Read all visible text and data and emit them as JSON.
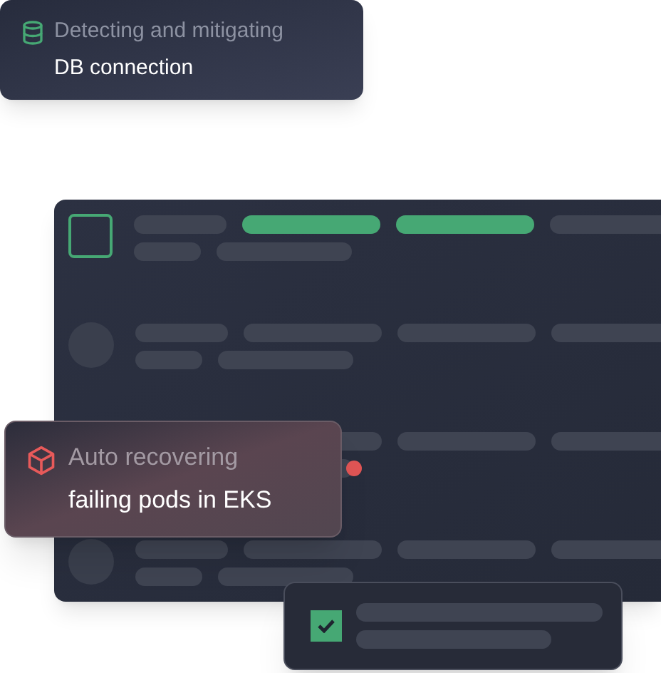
{
  "alert_cards": [
    {
      "kind": "database",
      "caption": "Detecting and mitigating",
      "subject": "DB connection"
    },
    {
      "kind": "box",
      "caption": "Auto recovering",
      "subject": "failing pods in EKS"
    }
  ],
  "list_rows": [
    {
      "kind": "checkbox",
      "checked": false,
      "highlighted": true,
      "flagged": false
    },
    {
      "kind": "avatar",
      "highlighted": false,
      "flagged": false
    },
    {
      "kind": "none",
      "highlighted": false,
      "flagged": true
    },
    {
      "kind": "avatar",
      "highlighted": false,
      "flagged": false
    }
  ],
  "task_card": {
    "checked": true
  }
}
